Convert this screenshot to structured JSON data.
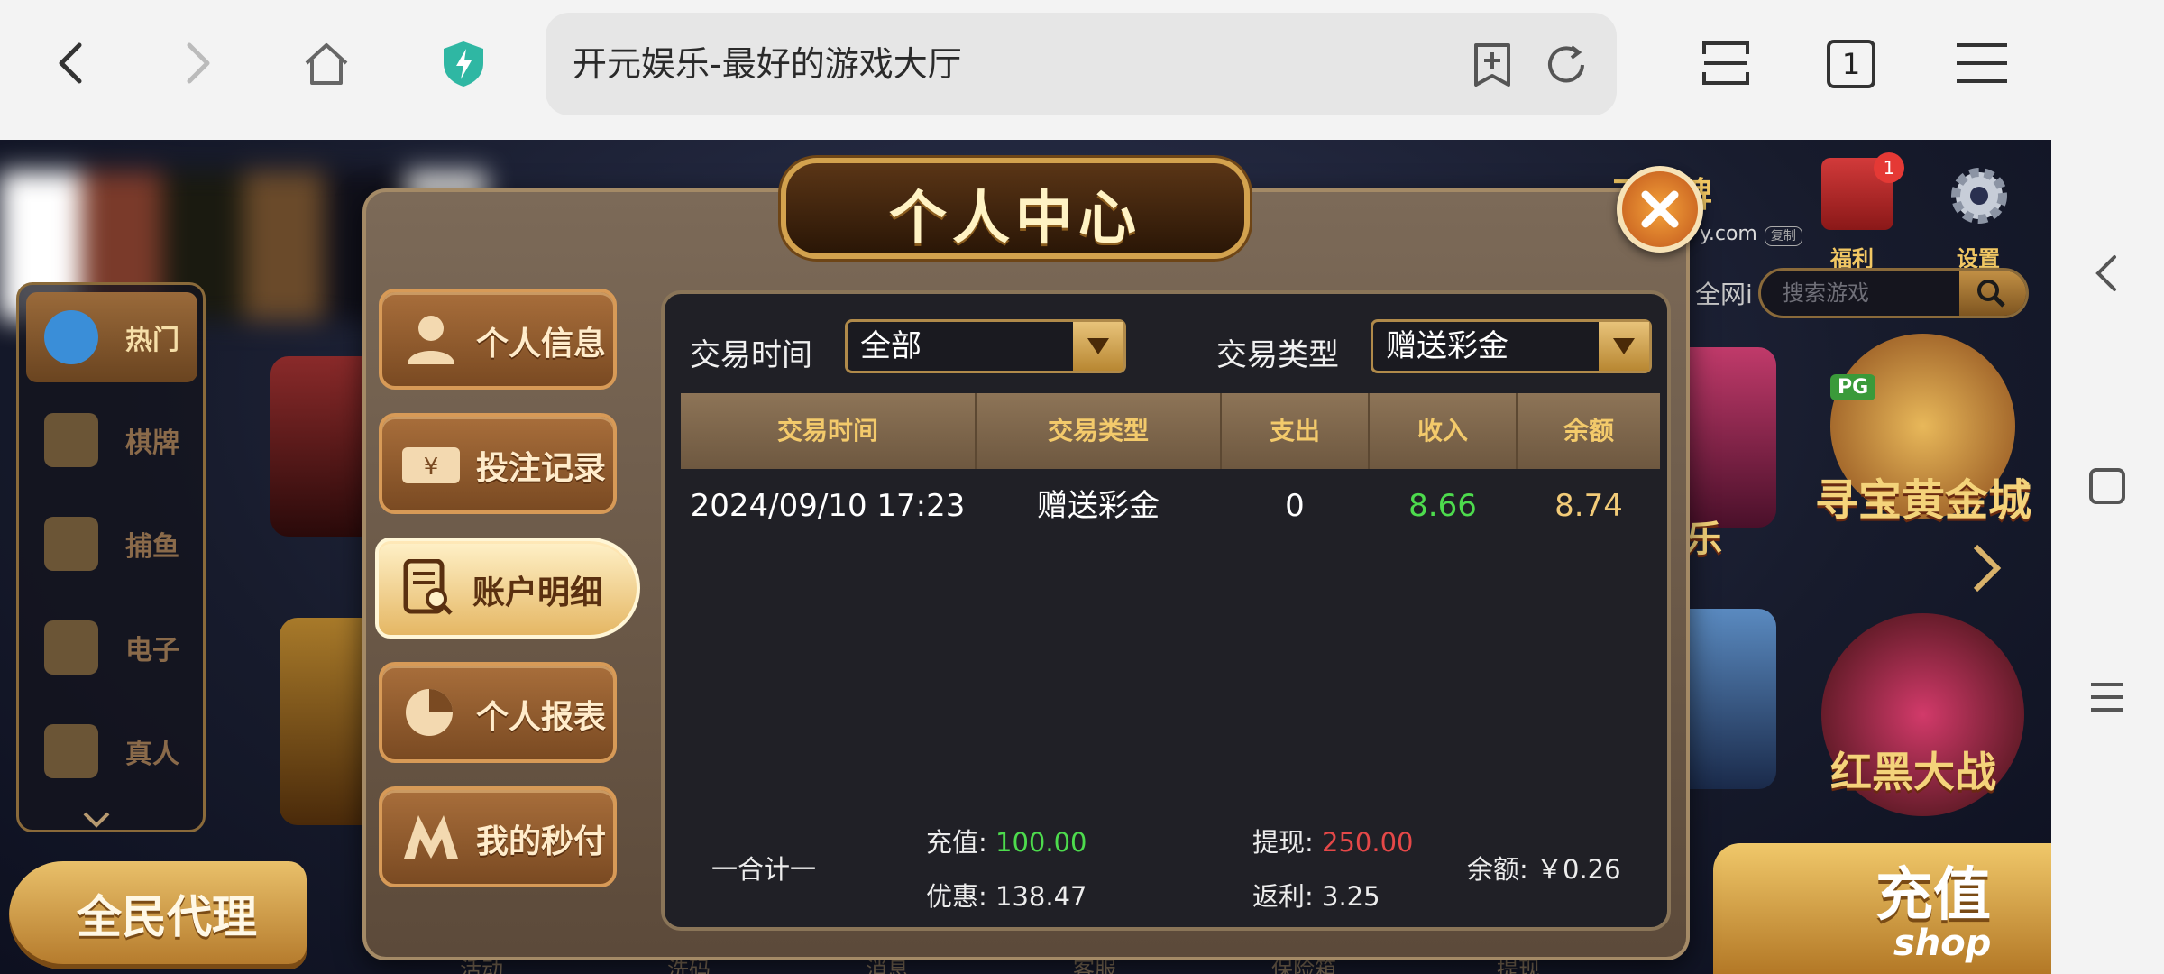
{
  "browser": {
    "url_title": "开元娱乐-最好的游戏大厅",
    "tab_count": "1"
  },
  "game": {
    "brand": "元棋牌",
    "brand_url": "y.com",
    "brand_copy": "复制",
    "welfare_label": "福利",
    "welfare_badge": "1",
    "settings_label": "设置",
    "search_partial": "全网i",
    "search_placeholder": "搜索游戏",
    "left_categories": [
      {
        "label": "热门",
        "icon": "hot-icon"
      },
      {
        "label": "棋牌",
        "icon": "cards-icon"
      },
      {
        "label": "捕鱼",
        "icon": "fish-icon"
      },
      {
        "label": "电子",
        "icon": "slot-icon"
      },
      {
        "label": "真人",
        "icon": "person-icon"
      }
    ],
    "agent_button": "全民代理",
    "shop_button": {
      "title": "充值",
      "sub": "shop"
    },
    "game_tiles": {
      "pg_badge": "PG",
      "gold_city": "寻宝黄金城",
      "red_black": "红黑大战",
      "partial_le": "乐",
      "partial_pg": "PG"
    },
    "bottom_nav": [
      "活动",
      "洗码",
      "消息",
      "客服",
      "保险箱",
      "提现"
    ]
  },
  "modal": {
    "title": "个人中心",
    "menu": [
      {
        "label": "个人信息",
        "icon": "user-icon"
      },
      {
        "label": "投注记录",
        "icon": "cash-icon"
      },
      {
        "label": "账户明细",
        "icon": "statement-icon"
      },
      {
        "label": "个人报表",
        "icon": "pie-chart-icon"
      },
      {
        "label": "我的秒付",
        "icon": "m-logo-icon"
      }
    ],
    "filters": {
      "time_label": "交易时间",
      "time_value": "全部",
      "type_label": "交易类型",
      "type_value": "赠送彩金"
    },
    "table": {
      "headers": [
        "交易时间",
        "交易类型",
        "支出",
        "收入",
        "余额"
      ],
      "rows": [
        [
          "2024/09/10 17:23",
          "赠送彩金",
          "0",
          "8.66",
          "8.74"
        ]
      ]
    },
    "summary": {
      "total_label": "一合计一",
      "recharge_label": "充值: ",
      "recharge_value": "100.00",
      "discount_label": "优惠: ",
      "discount_value": "138.47",
      "withdraw_label": "提现: ",
      "withdraw_value": "250.00",
      "rebate_label": "返利: ",
      "rebate_value": "3.25",
      "balance_label": "余额: ",
      "balance_value": "￥0.26"
    }
  },
  "colors": {
    "income_green": "#4ddb4d",
    "withdraw_red": "#e54848",
    "balance_gold": "#f2cb78",
    "header_gold": "#f3ca6b"
  }
}
